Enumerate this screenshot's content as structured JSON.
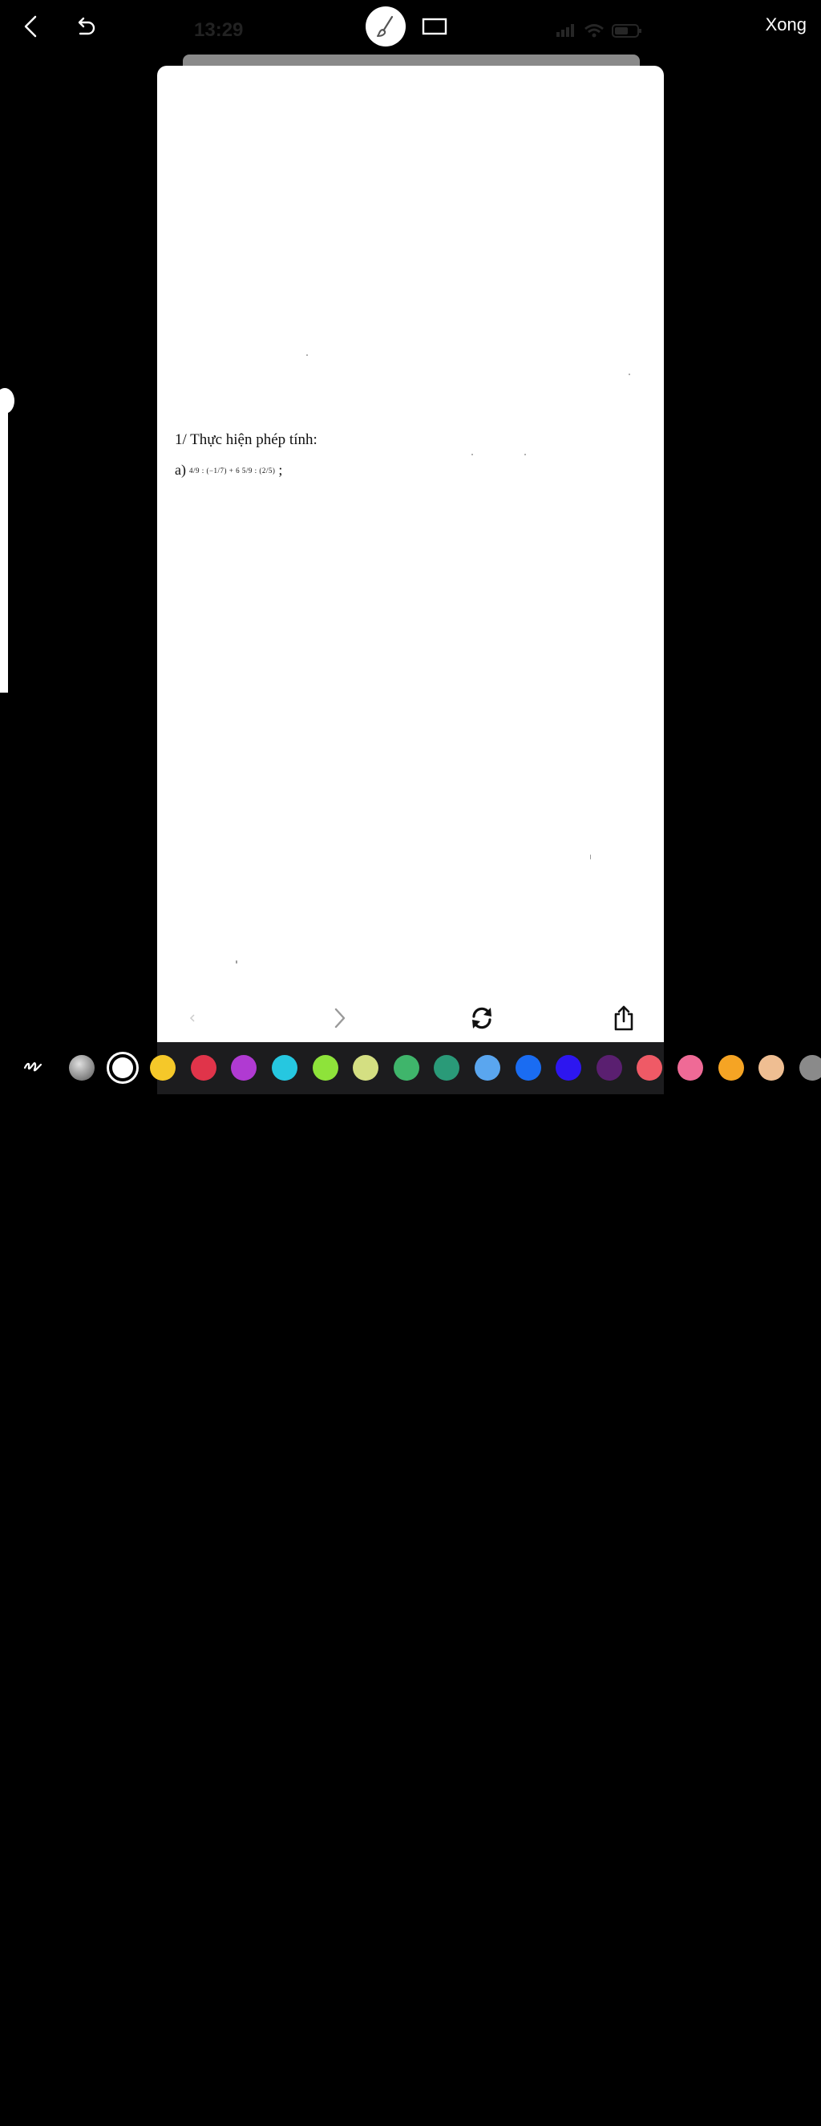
{
  "status_bar": {
    "time": "13:29"
  },
  "toolbar": {
    "done_label": "Xong",
    "back_icon": "chevron-left-icon",
    "undo_icon": "undo-icon",
    "brush_icon": "brush-icon",
    "rect_icon": "rectangle-icon"
  },
  "document": {
    "heading": "1/ Thực hiện phép tính:",
    "item_label": "a)",
    "formula": "4/9 : (−1/7) + 6 5/9 : (2/5)",
    "item_end": ";"
  },
  "page_nav": {
    "prev_icon": "chevron-left-icon",
    "next_icon": "chevron-right-icon",
    "rotate_icon": "rotate-icon",
    "share_icon": "share-icon"
  },
  "palette": {
    "pen_icon": "scribble-icon",
    "selected": "#ffffff",
    "colors": [
      "#8e8e8e",
      "#ffffff",
      "#f5c829",
      "#e0344a",
      "#b03ad2",
      "#26c7e0",
      "#8ee33a",
      "#d4df82",
      "#3fb56b",
      "#2a9a78",
      "#5aa6ef",
      "#1a6cf2",
      "#2d16f0",
      "#5a1f70",
      "#ef5a66",
      "#ef6a96",
      "#f5a424",
      "#efbe92",
      "#8a8a8a"
    ]
  }
}
